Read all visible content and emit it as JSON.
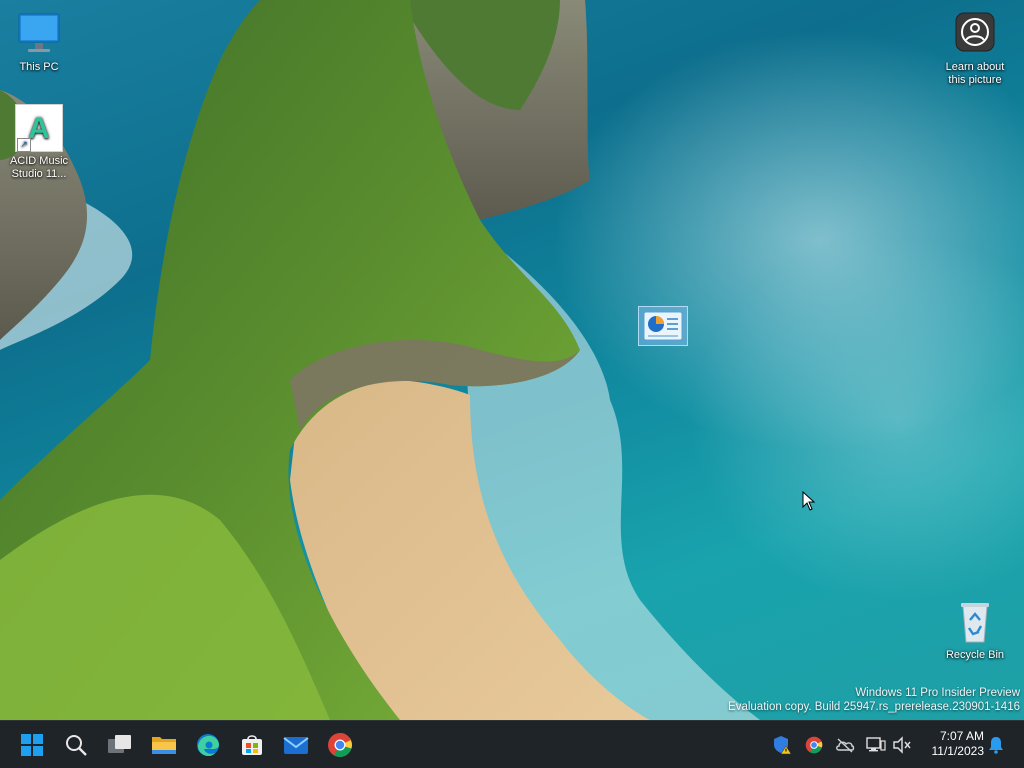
{
  "desktop": {
    "icons": [
      {
        "label": "This PC"
      },
      {
        "label": "ACID Music Studio 11...",
        "badge": "A"
      },
      {
        "label": "Learn about this picture"
      },
      {
        "label": "Recycle Bin"
      }
    ],
    "watermark": {
      "line1": "Windows 11 Pro Insider Preview",
      "line2": "Evaluation copy. Build 25947.rs_prerelease.230901-1416"
    }
  },
  "taskbar": {
    "apps": [
      {
        "name": "start-icon"
      },
      {
        "name": "search-icon"
      },
      {
        "name": "task-view-icon"
      },
      {
        "name": "file-explorer-icon"
      },
      {
        "name": "edge-icon"
      },
      {
        "name": "microsoft-store-icon"
      },
      {
        "name": "mail-icon"
      },
      {
        "name": "chrome-icon"
      }
    ],
    "tray": [
      "security-warning-icon",
      "chrome-tray-icon",
      "onedrive-offline-icon",
      "network-icon",
      "volume-muted-icon"
    ],
    "clock": {
      "time": "7:07 AM",
      "date": "11/1/2023"
    },
    "colors": {
      "background": "#1f2429",
      "accent": "#0078d4"
    }
  }
}
